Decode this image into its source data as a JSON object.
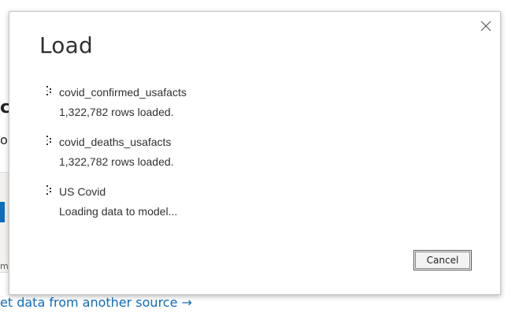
{
  "background": {
    "heading_fragment": "c",
    "subtext_fragment": "ou",
    "card_caption_fragment": "m",
    "link_text": "et data from another source →",
    "accent_color": "#0f6cbd"
  },
  "dialog": {
    "title": "Load",
    "close_icon": "close-icon",
    "items": [
      {
        "name": "covid_confirmed_usafacts",
        "status": "1,322,782 rows loaded.",
        "icon": "loading-spinner-icon"
      },
      {
        "name": "covid_deaths_usafacts",
        "status": "1,322,782 rows loaded.",
        "icon": "loading-spinner-icon"
      },
      {
        "name": "US Covid",
        "status": "Loading data to model...",
        "icon": "loading-spinner-icon"
      }
    ],
    "cancel_label": "Cancel"
  }
}
